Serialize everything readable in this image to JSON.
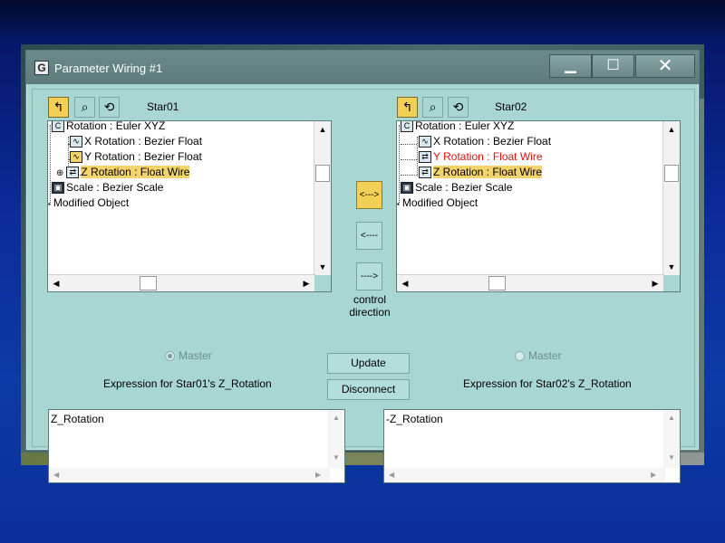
{
  "window": {
    "title": "Parameter Wiring #1",
    "app_icon_glyph": "G",
    "controls": {
      "minimize": "▁",
      "maximize": "☐",
      "close": "✕"
    }
  },
  "left_panel": {
    "node_name": "Star01",
    "tree": [
      {
        "label": "Rotation : Euler XYZ",
        "icon": "rotation-icon"
      },
      {
        "label": "X Rotation : Bezier Float",
        "icon": "bezier-curve-icon"
      },
      {
        "label": "Y Rotation : Bezier Float",
        "icon": "bezier-curve-icon"
      },
      {
        "label": "Z Rotation : Float Wire",
        "icon": "wire-icon",
        "selected": true
      },
      {
        "label": "Scale : Bezier Scale",
        "icon": "scale-icon"
      },
      {
        "label": "Modified Object",
        "icon": ""
      }
    ],
    "master_label": "Master",
    "master_checked": true,
    "expression_label": "Expression for Star01's Z_Rotation",
    "expression_text": "Z_Rotation"
  },
  "right_panel": {
    "node_name": "Star02",
    "tree": [
      {
        "label": "Rotation : Euler XYZ",
        "icon": "rotation-icon"
      },
      {
        "label": "X Rotation : Bezier Float",
        "icon": "bezier-curve-icon"
      },
      {
        "label": "Y Rotation : Float Wire",
        "icon": "wire-icon",
        "wired": true
      },
      {
        "label": "Z Rotation : Float Wire",
        "icon": "wire-icon",
        "selected": true
      },
      {
        "label": "Scale : Bezier Scale",
        "icon": "scale-icon"
      },
      {
        "label": "Modified Object",
        "icon": ""
      }
    ],
    "master_label": "Master",
    "master_checked": false,
    "expression_label": "Expression for Star02's Z_Rotation",
    "expression_text": "-Z_Rotation"
  },
  "direction": {
    "both": "<--->",
    "left": "<----",
    "right": "---->",
    "active": "both",
    "label_line1": "control",
    "label_line2": "direction"
  },
  "buttons": {
    "update": "Update",
    "disconnect": "Disconnect"
  },
  "colors": {
    "dialog_bg": "#a8d6d3",
    "selection": "#f3d36b",
    "wired_text": "#e01010",
    "active_button": "#f2cf55"
  }
}
